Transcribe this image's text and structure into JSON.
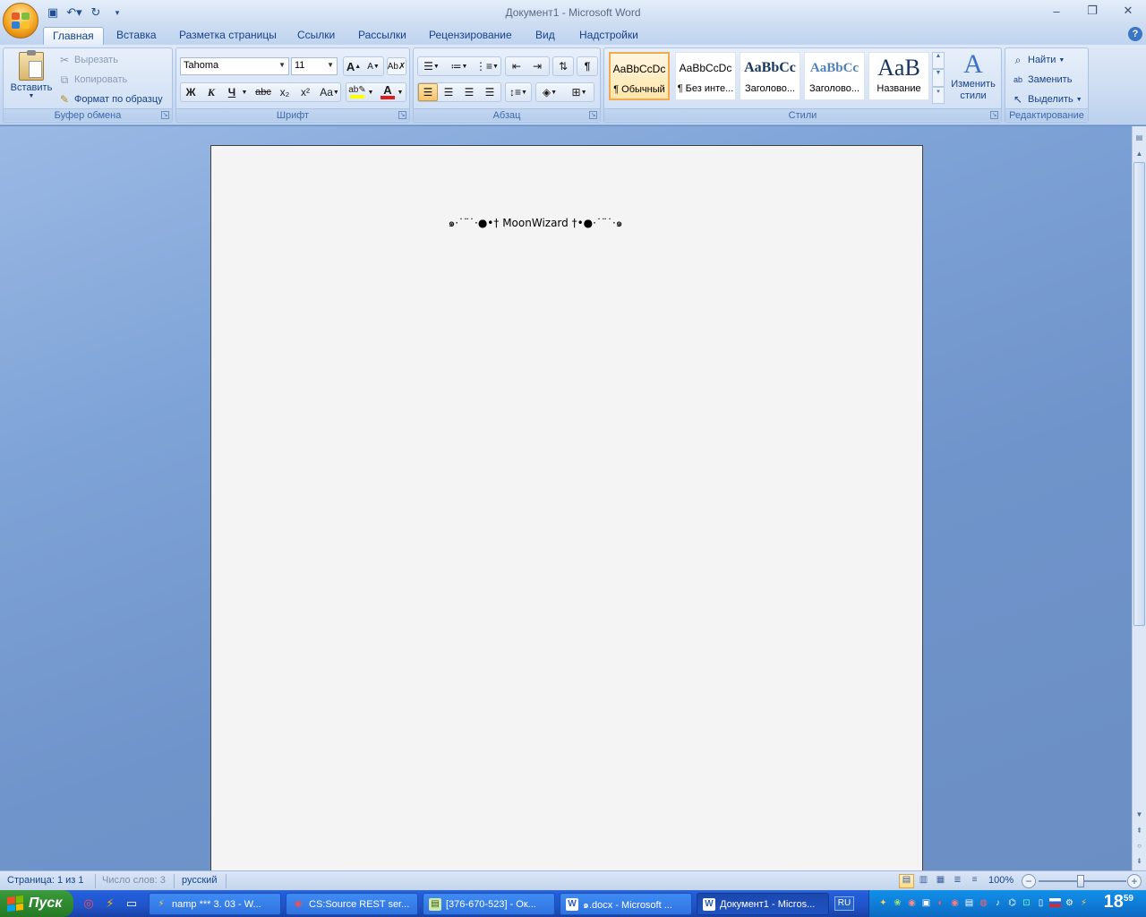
{
  "window": {
    "title": "Документ1 - Microsoft Word",
    "minimize": "–",
    "maximize": "❐",
    "close": "✕"
  },
  "tabs": [
    "Главная",
    "Вставка",
    "Разметка страницы",
    "Ссылки",
    "Рассылки",
    "Рецензирование",
    "Вид",
    "Надстройки"
  ],
  "clipboard": {
    "paste": "Вставить",
    "cut": "Вырезать",
    "copy": "Копировать",
    "format_painter": "Формат по образцу",
    "label": "Буфер обмена"
  },
  "font": {
    "name": "Tahoma",
    "size": "11",
    "label": "Шрифт",
    "bold": "Ж",
    "italic": "К",
    "underline": "Ч",
    "strike": "abc",
    "subscript": "x₂",
    "superscript": "x²",
    "change_case": "Aa",
    "grow": "A",
    "shrink": "A"
  },
  "paragraph": {
    "label": "Абзац"
  },
  "styles": {
    "label": "Стили",
    "items": [
      {
        "sample": "AaBbCcDc",
        "name": "¶ Обычный"
      },
      {
        "sample": "AaBbCcDc",
        "name": "¶ Без инте..."
      },
      {
        "sample": "AaBbCc",
        "name": "Заголово..."
      },
      {
        "sample": "AaBbCc",
        "name": "Заголово..."
      },
      {
        "sample": "AaB",
        "name": "Название"
      }
    ],
    "change_styles": "Изменить стили"
  },
  "editing": {
    "label": "Редактирование",
    "find": "Найти",
    "replace": "Заменить",
    "select": "Выделить"
  },
  "document": {
    "text": "๑·˙¨˙·●•† MoonWizard †•●·˙¨˙·๑"
  },
  "status": {
    "page": "Страница: 1 из 1",
    "words": "Число слов: 3",
    "language": "русский",
    "zoom": "100%"
  },
  "taskbar": {
    "start": "Пуск",
    "tasks": [
      {
        "label": "namp *** 3. 03 - W...",
        "icon": "⚡",
        "color": "#f4b400"
      },
      {
        "label": "CS:Source REST ser...",
        "icon": "◉",
        "color": "#d22"
      },
      {
        "label": "[376-670-523] - Ок...",
        "icon": "▤",
        "color": "#6c3"
      },
      {
        "label": "๑.docx - Microsoft ...",
        "icon": "W",
        "color": "#2b5fb4"
      },
      {
        "label": "Документ1 - Micros...",
        "icon": "W",
        "color": "#2b5fb4"
      }
    ],
    "lang": "RU",
    "clock_hour": "18",
    "clock_min": "59"
  },
  "colors": {
    "accent": "#15428b",
    "desktop": "#6b8fc4",
    "page": "#f4f4f4"
  }
}
